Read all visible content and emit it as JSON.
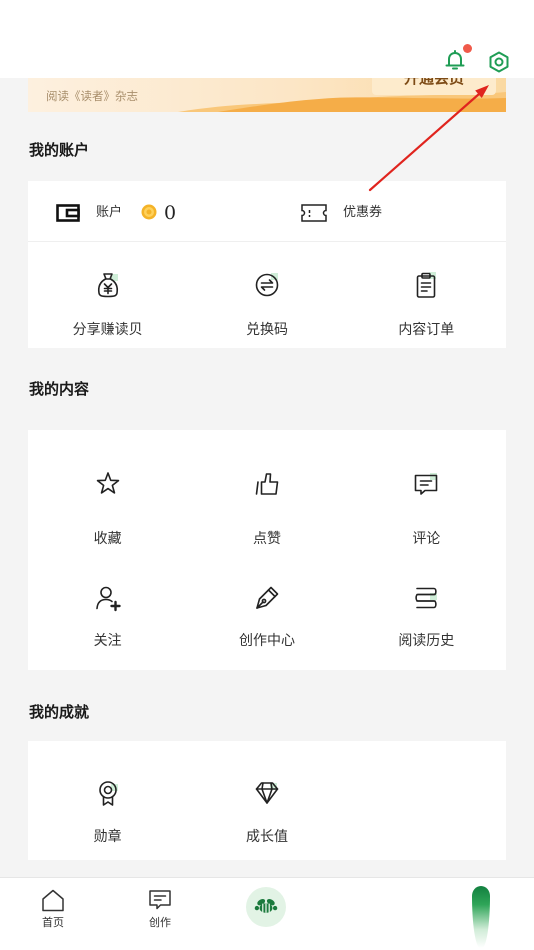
{
  "colors": {
    "accent_green": "#1f9d55",
    "notification_dot": "#f05a4a",
    "page_background": "#f4f4f4",
    "card_background": "#ffffff",
    "icon_accent": "#cfeed8",
    "annotation_arrow": "#e0241e"
  },
  "header": {
    "notification_icon": "bell-icon",
    "notification_unread": true,
    "settings_icon": "settings-icon"
  },
  "banner": {
    "text": "阅读《读者》杂志",
    "button_label": "开通会员"
  },
  "account": {
    "title": "我的账户",
    "wallet": {
      "icon": "wallet-icon",
      "label": "账户",
      "coin_icon": "coin-icon",
      "balance": "0"
    },
    "coupon": {
      "icon": "ticket-icon",
      "label": "优惠券"
    },
    "items": [
      {
        "icon": "money-bag-icon",
        "label": "分享赚读贝"
      },
      {
        "icon": "exchange-icon",
        "label": "兑换码"
      },
      {
        "icon": "clipboard-icon",
        "label": "内容订单"
      }
    ]
  },
  "content": {
    "title": "我的内容",
    "items": [
      {
        "icon": "star-icon",
        "label": "收藏"
      },
      {
        "icon": "thumbs-up-icon",
        "label": "点赞"
      },
      {
        "icon": "comment-icon",
        "label": "评论"
      },
      {
        "icon": "user-add-icon",
        "label": "关注"
      },
      {
        "icon": "pen-icon",
        "label": "创作中心"
      },
      {
        "icon": "books-icon",
        "label": "阅读历史"
      }
    ]
  },
  "achievements": {
    "title": "我的成就",
    "items": [
      {
        "icon": "medal-icon",
        "label": "勋章"
      },
      {
        "icon": "diamond-icon",
        "label": "成长值"
      }
    ]
  },
  "tabbar": {
    "items": [
      {
        "icon": "home-icon",
        "label": "首页"
      },
      {
        "icon": "create-icon",
        "label": "创作"
      }
    ],
    "center_icon": "bee-logo-icon",
    "right_icon": "profile-icon"
  }
}
